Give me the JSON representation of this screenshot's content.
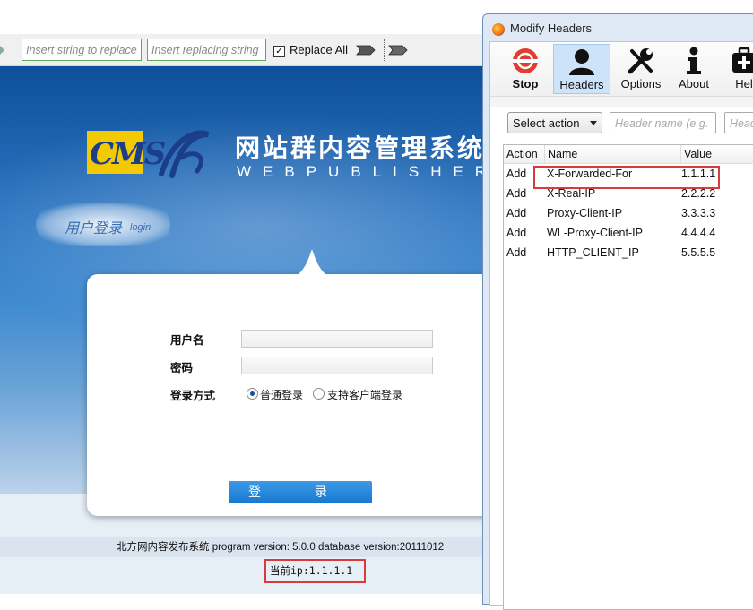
{
  "toolbar": {
    "find_placeholder": "Insert string to replace",
    "replace_placeholder": "Insert replacing string",
    "replace_all_label": "Replace All",
    "replace_all_checked": true
  },
  "page": {
    "logo_text": "CMS",
    "title_cn": "网站群内容管理系统",
    "title_en": "WEBPUBLISHER",
    "login_tab_cn": "用户登录",
    "login_tab_en": "login",
    "form": {
      "username_label": "用户名",
      "password_label": "密码",
      "login_mode_label": "登录方式",
      "option_normal": "普通登录",
      "option_client": "支持客户端登录",
      "selected_option": "normal",
      "login_button": "登 录"
    },
    "footer_version": "北方网内容发布系统 program version: 5.0.0  database version:20111012",
    "current_ip": "当前ip:1.1.1.1"
  },
  "modify_headers": {
    "window_title": "Modify Headers",
    "toolbar": [
      {
        "label": "Stop",
        "icon": "stop-icon",
        "bold": true
      },
      {
        "label": "Headers",
        "icon": "headers-icon",
        "selected": true
      },
      {
        "label": "Options",
        "icon": "options-icon"
      },
      {
        "label": "About",
        "icon": "about-icon"
      },
      {
        "label": "Hel",
        "icon": "help-icon"
      }
    ],
    "select_action": "Select action",
    "header_name_placeholder": "Header name (e.g. ",
    "header_value_placeholder": "Heac",
    "columns": [
      "Action",
      "Name",
      "Value"
    ],
    "rows": [
      {
        "action": "Add",
        "name": "X-Forwarded-For",
        "value": "1.1.1.1"
      },
      {
        "action": "Add",
        "name": "X-Real-IP",
        "value": "2.2.2.2"
      },
      {
        "action": "Add",
        "name": "Proxy-Client-IP",
        "value": "3.3.3.3"
      },
      {
        "action": "Add",
        "name": "WL-Proxy-Client-IP",
        "value": "4.4.4.4"
      },
      {
        "action": "Add",
        "name": "HTTP_CLIENT_IP",
        "value": "5.5.5.5"
      }
    ]
  }
}
